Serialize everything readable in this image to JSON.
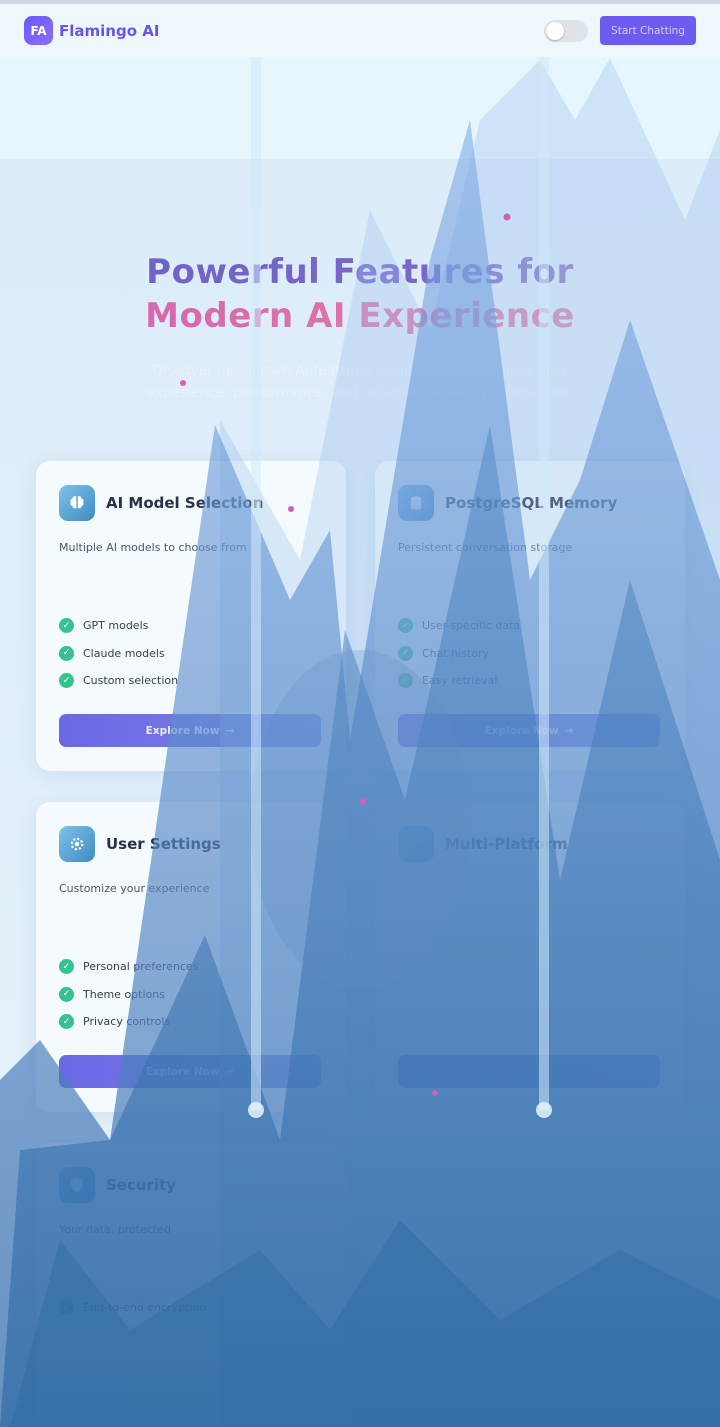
{
  "header": {
    "logo_initials": "FA",
    "brand_name": "Flamingo AI",
    "cta_label": "Start Chatting",
    "theme_toggle_on": false
  },
  "hero": {
    "title_line1": "Powerful Features for",
    "title_line2": "Modern AI Experience",
    "subtitle": "Discover innovative AI features designed for seamless user experience, performance, and reliability in every interaction."
  },
  "cards": [
    {
      "title": "AI Model Selection",
      "description": "Multiple AI models to choose from",
      "icon": "brain-icon",
      "features": [
        "GPT models",
        "Claude models",
        "Custom selection"
      ],
      "button_label": "Explore Now"
    },
    {
      "title": "PostgreSQL Memory",
      "description": "Persistent conversation storage",
      "icon": "database-icon",
      "features": [
        "User-specific data",
        "Chat history",
        "Easy retrieval"
      ],
      "button_label": "Explore Now"
    },
    {
      "title": "User Settings",
      "description": "Customize your experience",
      "icon": "gear-icon",
      "features": [
        "Personal preferences",
        "Theme options",
        "Privacy controls"
      ],
      "button_label": "Explore Now"
    },
    {
      "title": "Multi-Platform",
      "description": "",
      "icon": "devices-icon",
      "features": [
        "",
        "",
        ""
      ],
      "button_label": ""
    },
    {
      "title": "Security",
      "description": "Your data, protected",
      "icon": "shield-icon",
      "features": [
        "End-to-end encryption",
        "",
        ""
      ],
      "button_label": ""
    }
  ],
  "colors": {
    "accent": "#6c5cf0",
    "brand_text": "#6a54e6",
    "check_green": "#34c38f",
    "mountain_blue": "#3f7ab5"
  }
}
